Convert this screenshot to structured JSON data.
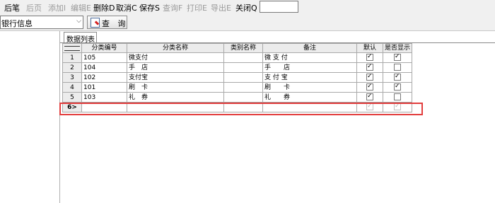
{
  "toolbar": {
    "buttons": [
      {
        "label": "后笔",
        "enabled": true
      },
      {
        "label": "后页",
        "enabled": false
      },
      {
        "label": "添加l",
        "enabled": false
      },
      {
        "label": "编辑E",
        "enabled": false
      },
      {
        "label": "删除D",
        "enabled": true
      },
      {
        "label": "取消C",
        "enabled": true
      },
      {
        "label": "保存S",
        "enabled": true
      },
      {
        "label": "查询F",
        "enabled": false
      },
      {
        "label": "打印E",
        "enabled": false
      },
      {
        "label": "导出E",
        "enabled": false
      },
      {
        "label": "关闭Q",
        "enabled": true
      }
    ],
    "input_value": ""
  },
  "filter": {
    "combo_value": "银行信息",
    "query_label": "查 询"
  },
  "tab": {
    "label": "数据列表"
  },
  "grid": {
    "columns": [
      "分类编号",
      "分类名称",
      "类别名称",
      "备注",
      "默认",
      "是否显示"
    ],
    "rows": [
      {
        "num": "1",
        "code": "105",
        "name": "微支付",
        "category": "",
        "note": "微 支 付",
        "default": true,
        "show": true
      },
      {
        "num": "2",
        "code": "104",
        "name": "手　店",
        "category": "",
        "note": "手　　店",
        "default": true,
        "show": false
      },
      {
        "num": "3",
        "code": "102",
        "name": "支付宝",
        "category": "",
        "note": "支 付 宝",
        "default": true,
        "show": true
      },
      {
        "num": "4",
        "code": "101",
        "name": "刷　卡",
        "category": "",
        "note": "刷　　卡",
        "default": true,
        "show": true
      },
      {
        "num": "5",
        "code": "103",
        "name": "礼　券",
        "category": "",
        "note": "礼　　券",
        "default": true,
        "show": false
      }
    ],
    "new_row": {
      "num": "6>",
      "default": true,
      "show": true
    }
  }
}
